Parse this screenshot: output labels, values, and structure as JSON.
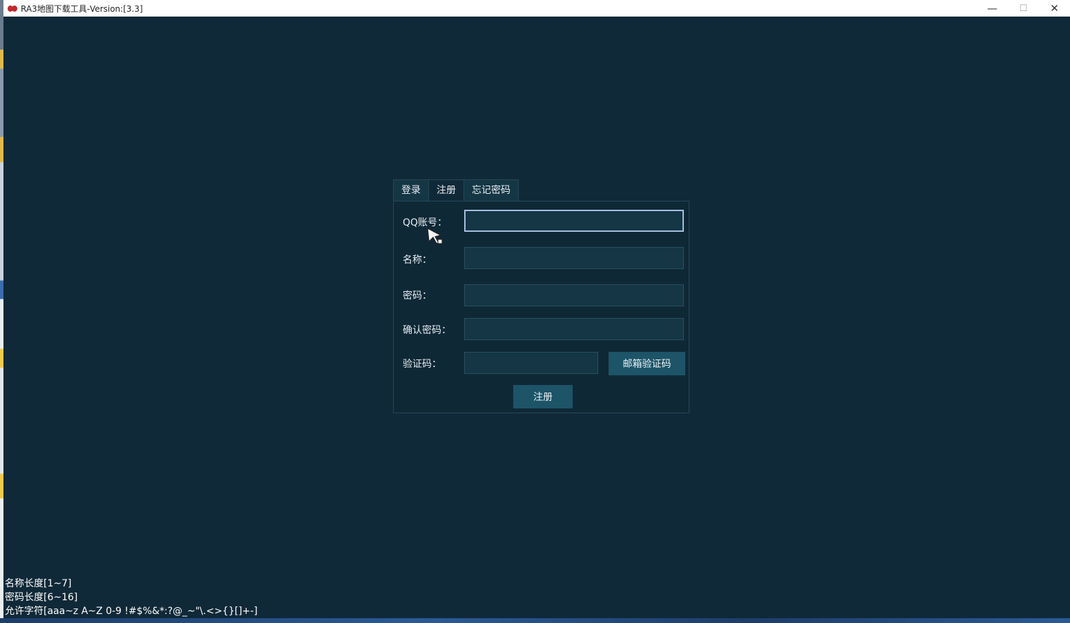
{
  "window": {
    "title": "RA3地图下载工具-Version:[3.3]",
    "minimize": "—",
    "maximize": "☐",
    "close": "✕"
  },
  "tabs": [
    {
      "label": "登录"
    },
    {
      "label": "注册",
      "active": true
    },
    {
      "label": "忘记密码"
    }
  ],
  "form": {
    "qq_label": "QQ账号：",
    "qq_value": "",
    "name_label": "名称：",
    "name_value": "",
    "password_label": "密码：",
    "password_value": "",
    "confirm_label": "确认密码：",
    "confirm_value": "",
    "code_label": "验证码：",
    "code_value": "",
    "email_code_button": "邮箱验证码",
    "submit_button": "注册"
  },
  "hints": [
    "名称长度[1~7]",
    "密码长度[6~16]",
    "允许字符[aaa~z A~Z 0-9 !#$%&*:?@_~\"\\.<>{}[]+-]"
  ],
  "colors": {
    "background": "#102938",
    "panel": "#0f2836",
    "field": "#143645",
    "button": "#1d5468",
    "focus_border": "#a9bfe0",
    "app_icon": "#c0282d"
  }
}
